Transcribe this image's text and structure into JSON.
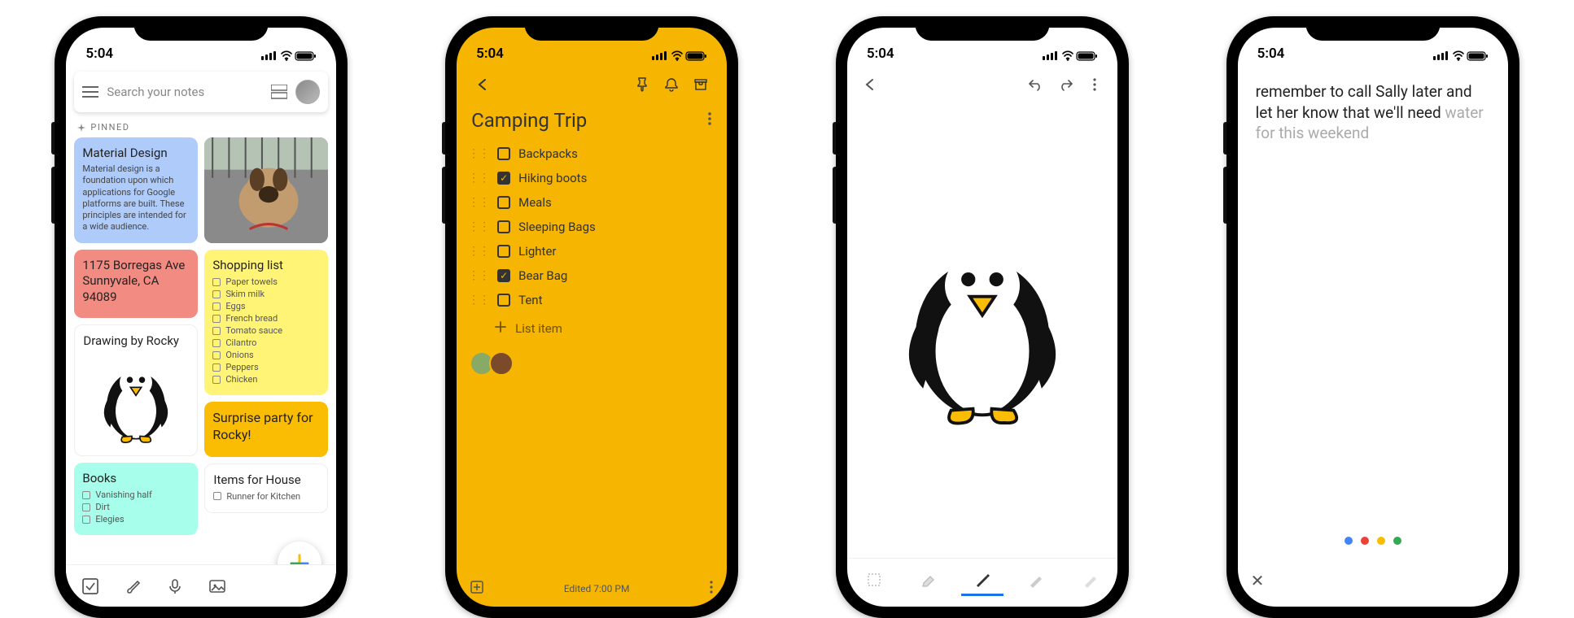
{
  "status": {
    "time": "5:04"
  },
  "screen1": {
    "search_placeholder": "Search your notes",
    "pinned_label": "PINNED",
    "notes": {
      "material": {
        "title": "Material Design",
        "body": "Material design is a foundation upon which applications for Google platforms are built. These principles are intended for a wide audience.",
        "color": "#aecbfa"
      },
      "address": {
        "title": "1175 Borregas Ave Sunnyvale, CA 94089",
        "color": "#f28b82"
      },
      "drawing": {
        "title": "Drawing by Rocky",
        "color": "#ffffff"
      },
      "books": {
        "title": "Books",
        "items": [
          "Vanishing half",
          "Dirt",
          "Elegies"
        ],
        "color": "#a7ffeb"
      },
      "shopping": {
        "title": "Shopping list",
        "items": [
          "Paper towels",
          "Skim milk",
          "Eggs",
          "French bread",
          "Tomato sauce",
          "Cilantro",
          "Onions",
          "Peppers",
          "Chicken"
        ],
        "color": "#fff475"
      },
      "surprise": {
        "title": "Surprise party for Rocky!",
        "color": "#fbbc04"
      },
      "house": {
        "title": "Items for House",
        "items": [
          "Runner for Kitchen"
        ],
        "color": "#ffffff"
      }
    }
  },
  "screen2": {
    "title": "Camping Trip",
    "items": [
      {
        "label": "Backpacks",
        "checked": false
      },
      {
        "label": "Hiking boots",
        "checked": true
      },
      {
        "label": "Meals",
        "checked": false
      },
      {
        "label": "Sleeping Bags",
        "checked": false
      },
      {
        "label": "Lighter",
        "checked": false
      },
      {
        "label": "Bear Bag",
        "checked": true
      },
      {
        "label": "Tent",
        "checked": false
      }
    ],
    "add_item": "List item",
    "edited": "Edited 7:00 PM"
  },
  "screen3": {
    "tools": [
      "select",
      "erase",
      "pen",
      "brush",
      "highlighter"
    ],
    "active_tool": 2
  },
  "screen4": {
    "text_typed": "remember to call Sally later and let her know that we'll need ",
    "text_pending": "water for this weekend",
    "dots": [
      "#4285f4",
      "#ea4335",
      "#fbbc04",
      "#34a853"
    ]
  }
}
